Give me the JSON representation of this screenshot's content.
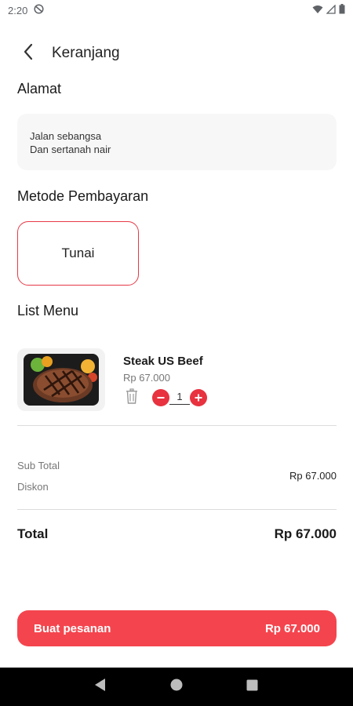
{
  "status_bar": {
    "time": "2:20"
  },
  "header": {
    "title": "Keranjang"
  },
  "address": {
    "section_title": "Alamat",
    "line1": "Jalan sebangsa",
    "line2": "Dan sertanah nair"
  },
  "payment": {
    "section_title": "Metode Pembayaran",
    "selected": "Tunai"
  },
  "menu": {
    "section_title": "List Menu",
    "items": [
      {
        "name": "Steak US Beef",
        "price": "Rp 67.000",
        "quantity": "1"
      }
    ]
  },
  "summary": {
    "subtotal_label": "Sub Total",
    "discount_label": "Diskon",
    "subtotal_value": "Rp 67.000",
    "total_label": "Total",
    "total_value": "Rp 67.000"
  },
  "order_button": {
    "label": "Buat pesanan",
    "amount": "Rp 67.000"
  },
  "colors": {
    "accent": "#f4454e",
    "selected_border": "#e63946"
  },
  "icons": [
    "back-arrow-icon",
    "trash-icon",
    "minus-icon",
    "plus-icon",
    "nav-back-icon",
    "nav-home-icon",
    "nav-recents-icon"
  ]
}
